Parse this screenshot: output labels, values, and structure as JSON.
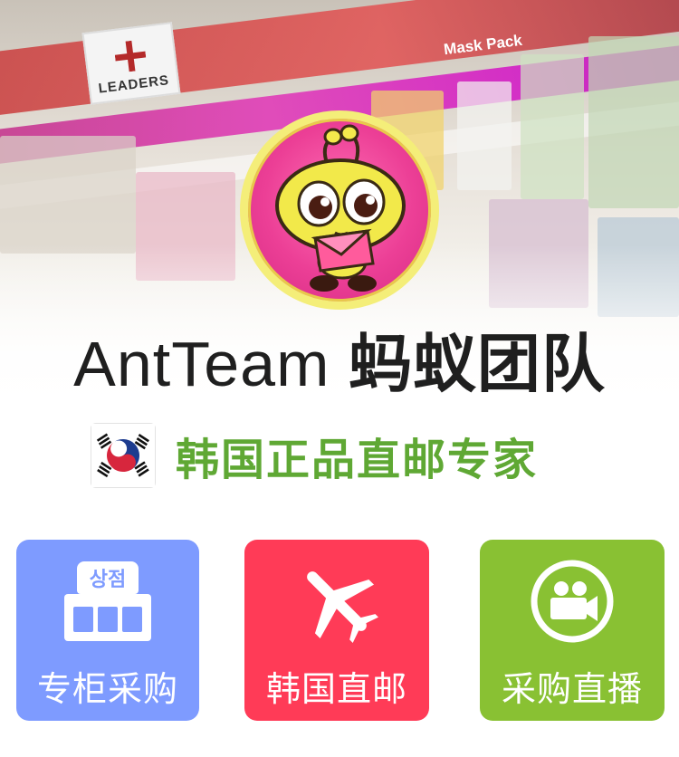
{
  "hero": {
    "brand_sign": "LEADERS",
    "shelf_label": "Mask Pack"
  },
  "title": {
    "en": "AntTeam",
    "cn": "蚂蚁团队"
  },
  "subtitle": "韩国正品直邮专家",
  "tiles": [
    {
      "label": "专柜采购",
      "icon_text": "상점",
      "color": "#7e9bff"
    },
    {
      "label": "韩国直邮",
      "color": "#ff3b57"
    },
    {
      "label": "采购直播",
      "color": "#89c133"
    }
  ],
  "colors": {
    "subtitle": "#5fa834",
    "mascot_ring": "#f4ee79",
    "mascot_bg": "#ec3f96"
  }
}
